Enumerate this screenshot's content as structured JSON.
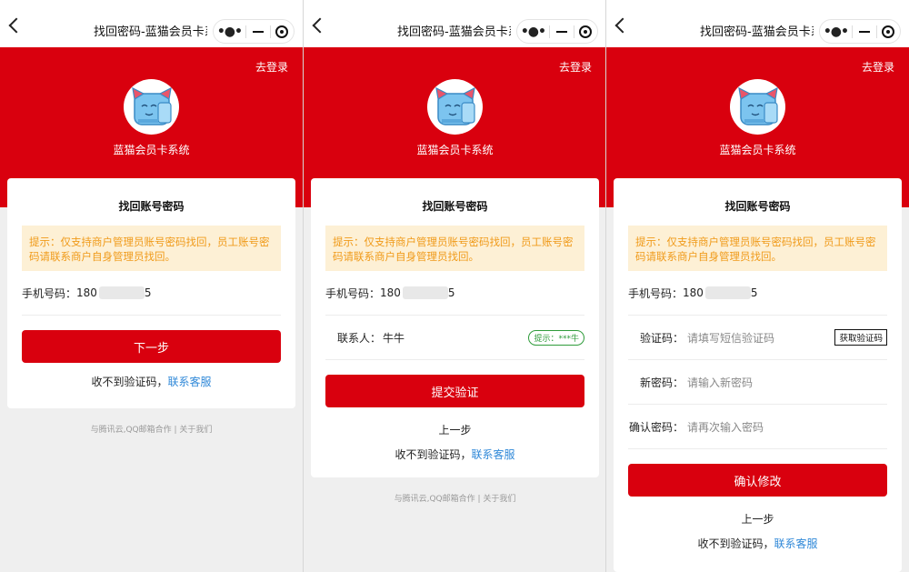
{
  "nav": {
    "title": "找回密码-蓝猫会员卡系...",
    "more": "•●•"
  },
  "hero": {
    "login": "去登录",
    "brand": "蓝猫会员卡系统"
  },
  "card": {
    "title": "找回账号密码",
    "tip": "提示：仅支持商户管理员账号密码找回，员工账号密码请联系商户自身管理员找回。",
    "phone_label": "手机号码：",
    "phone_prefix": "180",
    "phone_suffix": "5",
    "help_prefix": "收不到验证码，",
    "help_link": "联系客服"
  },
  "screen1": {
    "next_button": "下一步"
  },
  "screen2": {
    "contact_label": "联系人：",
    "contact_value": "牛牛",
    "contact_hint": "提示：***牛",
    "submit_button": "提交验证",
    "prev": "上一步"
  },
  "screen3": {
    "code_label": "验证码：",
    "code_placeholder": "请填写短信验证码",
    "get_code": "获取验证码",
    "newpw_label": "新密码：",
    "newpw_placeholder": "请输入新密码",
    "confirm_label": "确认密码：",
    "confirm_placeholder": "请再次输入密码",
    "confirm_button": "确认修改",
    "prev": "上一步"
  },
  "footer": "与腾讯云,QQ邮箱合作 | 关于我们",
  "colors": {
    "brand_red": "#d9000e",
    "tip_bg": "#fdf0d5",
    "tip_text": "#f09a19",
    "link_blue": "#2f88d8",
    "hint_green": "#2e9b3a"
  }
}
